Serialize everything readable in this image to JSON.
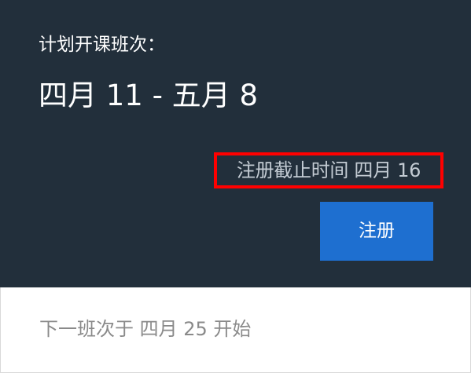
{
  "upcoming": {
    "section_label": "计划开课班次：",
    "date_range": "四月 11 - 五月 8",
    "deadline": "注册截止时间 四月 16",
    "register_label": "注册"
  },
  "next": {
    "text": "下一班次于 四月 25 开始"
  },
  "colors": {
    "panel_background": "#222f3b",
    "button_background": "#1e6fd0",
    "highlight_border": "#ff0000"
  }
}
